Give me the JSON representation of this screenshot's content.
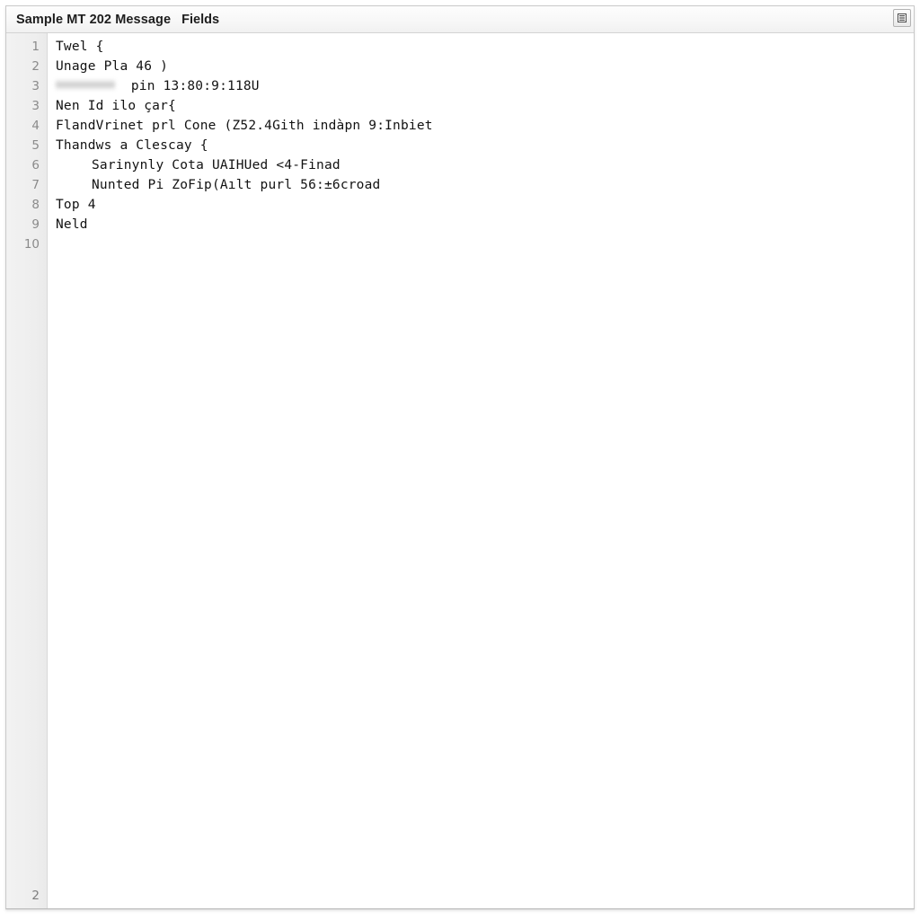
{
  "window": {
    "title": "Sample MT 202 Message",
    "subtitle": "Fields",
    "panel_button_icon": "panel-layout-icon",
    "panel_button_label": "Toggle panel"
  },
  "editor": {
    "gutter": {
      "numbers": [
        "1",
        "2",
        "3",
        "3",
        "4",
        "5",
        "6",
        "7",
        "8",
        "9",
        "10"
      ],
      "bottom_marker": "2"
    },
    "lines": [
      {
        "num": "1",
        "text": "Twel {",
        "indent": false,
        "redacted": false
      },
      {
        "num": "2",
        "text": "Unage Pla 46 )",
        "indent": false,
        "redacted": false
      },
      {
        "num": "3",
        "text": "pin 13:80:9:118U",
        "indent": false,
        "redacted": true
      },
      {
        "num": "3",
        "text": "Nen Id ilo çar{",
        "indent": false,
        "redacted": false
      },
      {
        "num": "4",
        "text": "FlandVrinet prl Cone (Z52.4Gith indàpn 9:Inbiet",
        "indent": false,
        "redacted": false
      },
      {
        "num": "5",
        "text": "Thandws a Clescay {",
        "indent": false,
        "redacted": false
      },
      {
        "num": "6",
        "text": "Sarinynly Cota UAIHUed <4-Finad",
        "indent": true,
        "redacted": false
      },
      {
        "num": "7",
        "text": "Nunted Pi ZoFip(Aılt purl 56:±6croad",
        "indent": true,
        "redacted": false
      },
      {
        "num": "8",
        "text": "Top 4",
        "indent": false,
        "redacted": false
      },
      {
        "num": "9",
        "text": "Neld",
        "indent": false,
        "redacted": false
      },
      {
        "num": "10",
        "text": "",
        "indent": false,
        "redacted": false
      }
    ]
  },
  "colors": {
    "window_background": "#ffffff",
    "titlebar_background": "#f7f7f7",
    "gutter_background": "#eeeeee",
    "gutter_text": "#8a8a8a",
    "code_text": "#121212",
    "border": "#c9c9c9"
  }
}
